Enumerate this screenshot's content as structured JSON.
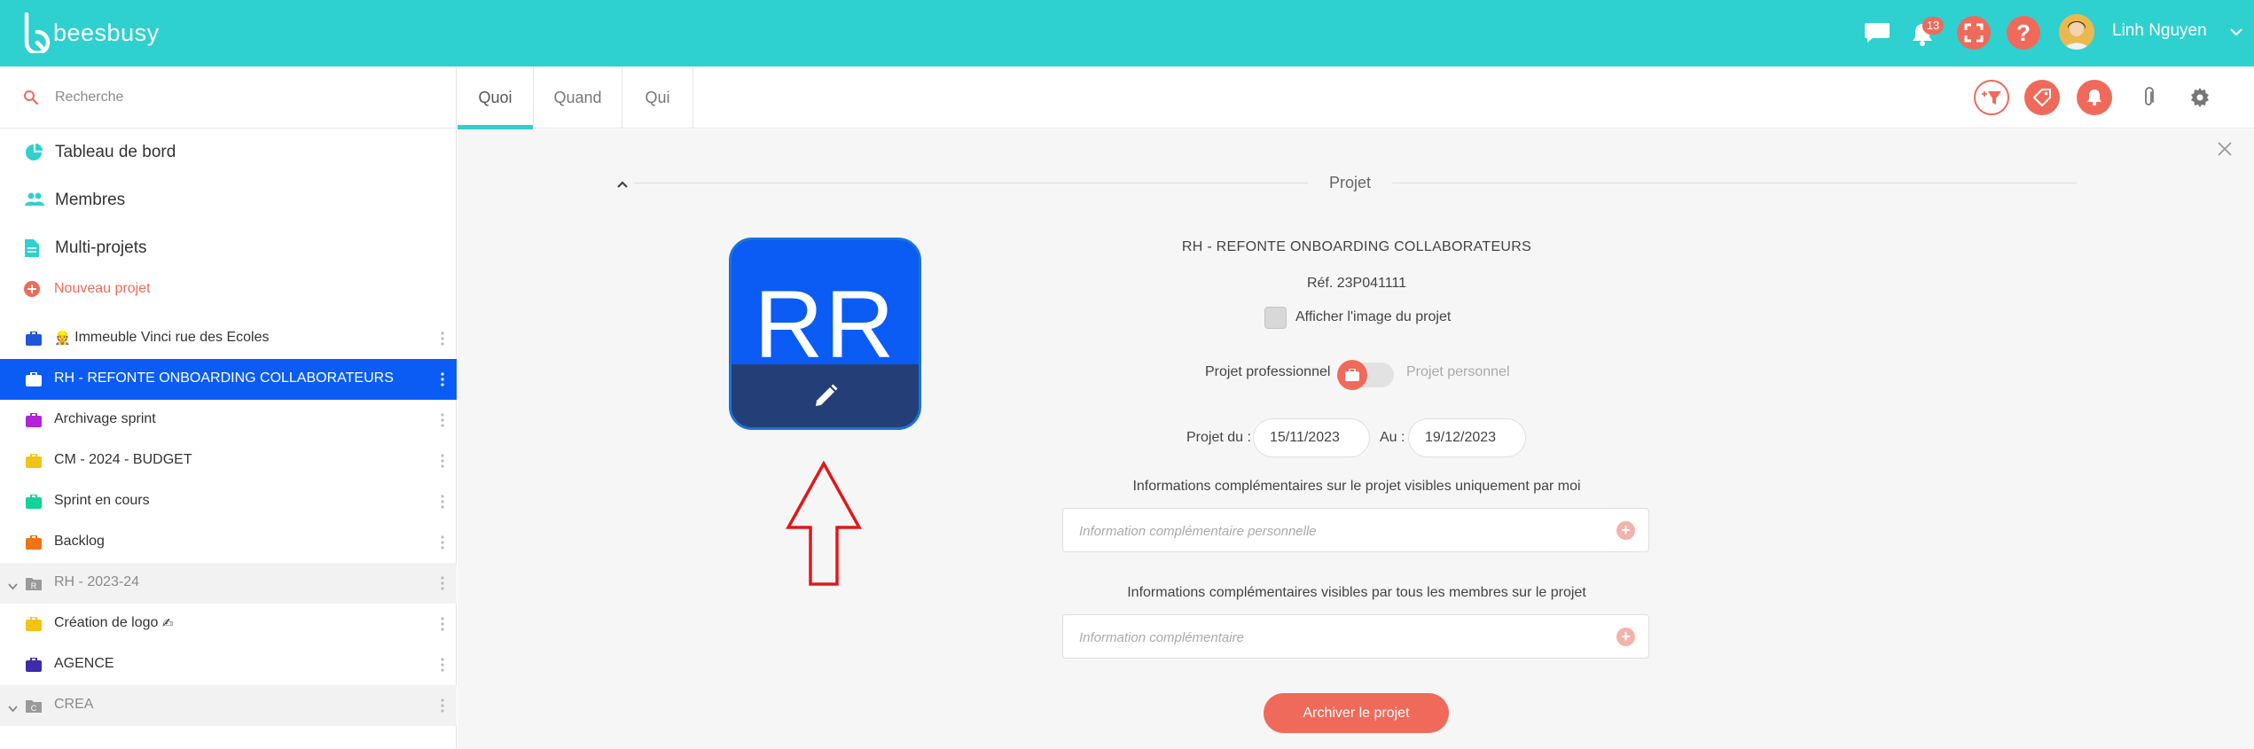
{
  "app": {
    "name": "beesbusy",
    "accent": "#2fd0d0",
    "brand_red": "#ef6a5a",
    "active_blue": "#0a5cf5"
  },
  "header": {
    "notifications_count": "13",
    "user_name": "Linh Nguyen",
    "icons": [
      "chat-icon",
      "bell-icon",
      "expand-icon",
      "help-icon",
      "chevron-down-icon"
    ],
    "help_label": "?"
  },
  "search": {
    "placeholder": "Recherche"
  },
  "nav": [
    {
      "label": "Tableau de bord",
      "icon": "dashboard-icon"
    },
    {
      "label": "Membres",
      "icon": "members-icon"
    },
    {
      "label": "Multi-projets",
      "icon": "document-icon"
    }
  ],
  "new_project": {
    "label": "Nouveau projet"
  },
  "projects": [
    {
      "label": "Immeuble Vinci rue des Ecoles",
      "emoji": "👷",
      "color": "#1e56d8",
      "active": false
    },
    {
      "label": "RH - REFONTE ONBOARDING COLLABORATEURS",
      "color": "#ffffff",
      "active": true
    },
    {
      "label": "Archivage sprint",
      "color": "#b322d8",
      "active": false
    },
    {
      "label": "CM - 2024 - BUDGET",
      "color": "#f2c316",
      "active": false
    },
    {
      "label": "Sprint en cours",
      "color": "#12d39a",
      "active": false
    },
    {
      "label": "Backlog",
      "color": "#f07318",
      "active": false
    },
    {
      "label": "RH - 2023-24",
      "group": true,
      "letter": "R"
    },
    {
      "label": "Création de logo",
      "emoji": "✍",
      "color": "#f2c316",
      "active": false
    },
    {
      "label": "AGENCE",
      "color": "#3d2ba8",
      "active": false
    },
    {
      "label": "CREA",
      "group": true,
      "letter": "C"
    }
  ],
  "tabs": [
    {
      "label": "Quoi",
      "active": true
    },
    {
      "label": "Quand",
      "active": false
    },
    {
      "label": "Qui",
      "active": false
    }
  ],
  "toolbar": {
    "icons": [
      "add-filter-icon",
      "tag-icon",
      "notification-icon",
      "attachment-icon",
      "settings-icon"
    ]
  },
  "panel": {
    "section_title": "Projet",
    "image_initials": "RR",
    "project_name": "RH - REFONTE ONBOARDING COLLABORATEURS",
    "reference": "Réf. 23P041111",
    "show_image_label": "Afficher l'image du projet",
    "show_image_checked": false,
    "professional_label": "Projet professionnel",
    "personal_label": "Projet personnel",
    "type": "professionnel",
    "from_label": "Projet du :",
    "date_from": "15/11/2023",
    "to_label": "Au :",
    "date_to": "19/12/2023",
    "private_info_title": "Informations complémentaires sur le projet visibles uniquement par moi",
    "private_info_placeholder": "Information complémentaire personnelle",
    "public_info_title": "Informations complémentaires visibles par tous les membres sur le projet",
    "public_info_placeholder": "Information complémentaire",
    "archive_label": "Archiver le projet"
  }
}
